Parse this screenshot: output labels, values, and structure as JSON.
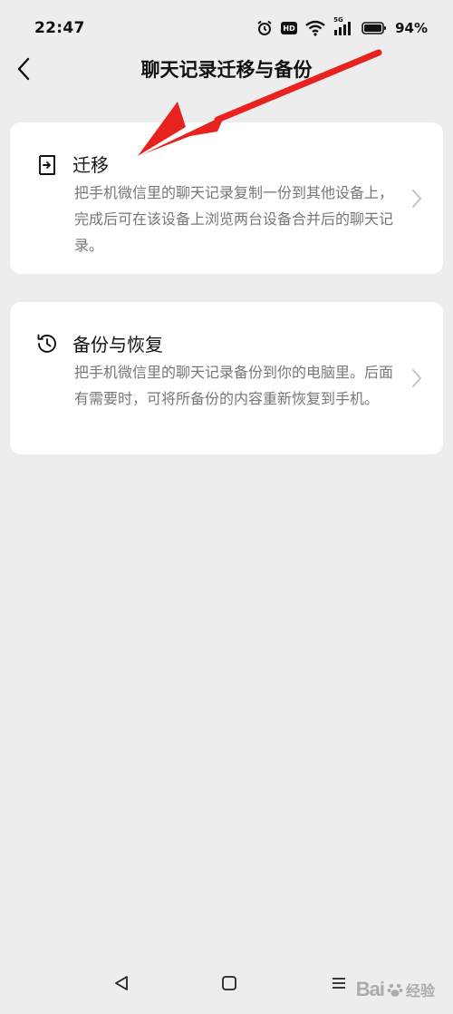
{
  "status_bar": {
    "time": "22:47",
    "battery": "94%",
    "hd": "HD",
    "network": "5G"
  },
  "nav": {
    "title": "聊天记录迁移与备份"
  },
  "items": [
    {
      "title": "迁移",
      "desc": "把手机微信里的聊天记录复制一份到其他设备上，完成后可在该设备上浏览两台设备合并后的聊天记录。",
      "icon": "migrate-icon"
    },
    {
      "title": "备份与恢复",
      "desc": "把手机微信里的聊天记录备份到你的电脑里。后面有需要时，可将所备份的内容重新恢复到手机。",
      "icon": "history-icon"
    }
  ],
  "watermark": {
    "logo": "Bai",
    "text": "经验"
  },
  "colors": {
    "background": "#ededed",
    "card": "#ffffff",
    "annotation_arrow": "#e8231f",
    "desc_text": "#777777"
  }
}
